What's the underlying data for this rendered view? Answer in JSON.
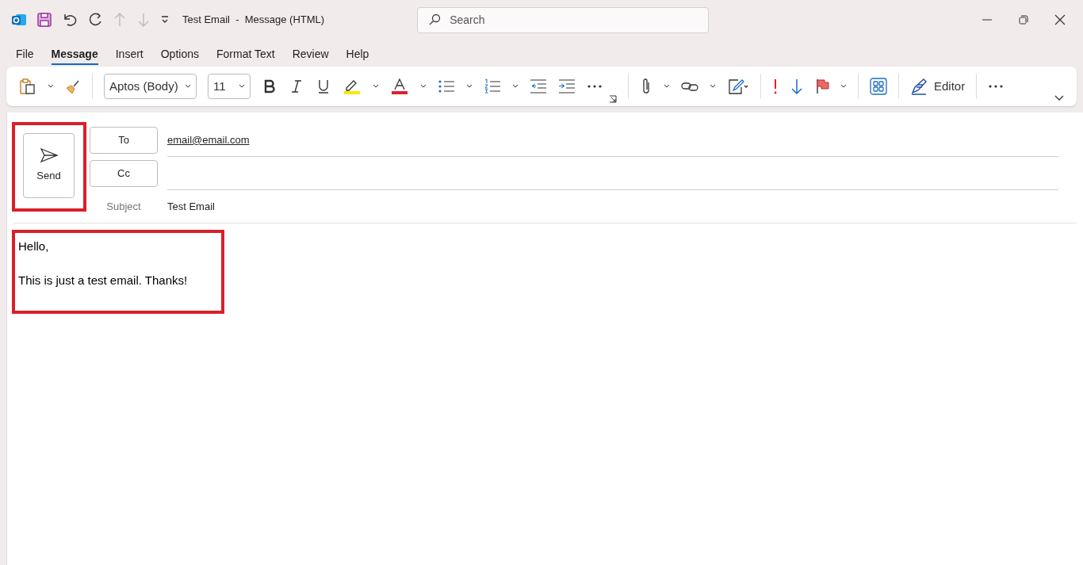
{
  "window": {
    "title": "Test Email  -  Message (HTML)"
  },
  "search": {
    "placeholder": "Search"
  },
  "tabs": [
    {
      "label": "File",
      "selected": false
    },
    {
      "label": "Message",
      "selected": true
    },
    {
      "label": "Insert",
      "selected": false
    },
    {
      "label": "Options",
      "selected": false
    },
    {
      "label": "Format Text",
      "selected": false
    },
    {
      "label": "Review",
      "selected": false
    },
    {
      "label": "Help",
      "selected": false
    }
  ],
  "ribbon": {
    "font": "Aptos (Body)",
    "size": "11",
    "editor": "Editor"
  },
  "compose": {
    "send": "Send",
    "to_label": "To",
    "to_value": "email@email.com",
    "cc_label": "Cc",
    "subject_label": "Subject",
    "subject_value": "Test Email",
    "body": [
      "Hello,",
      "This is just a test email. Thanks!"
    ]
  }
}
